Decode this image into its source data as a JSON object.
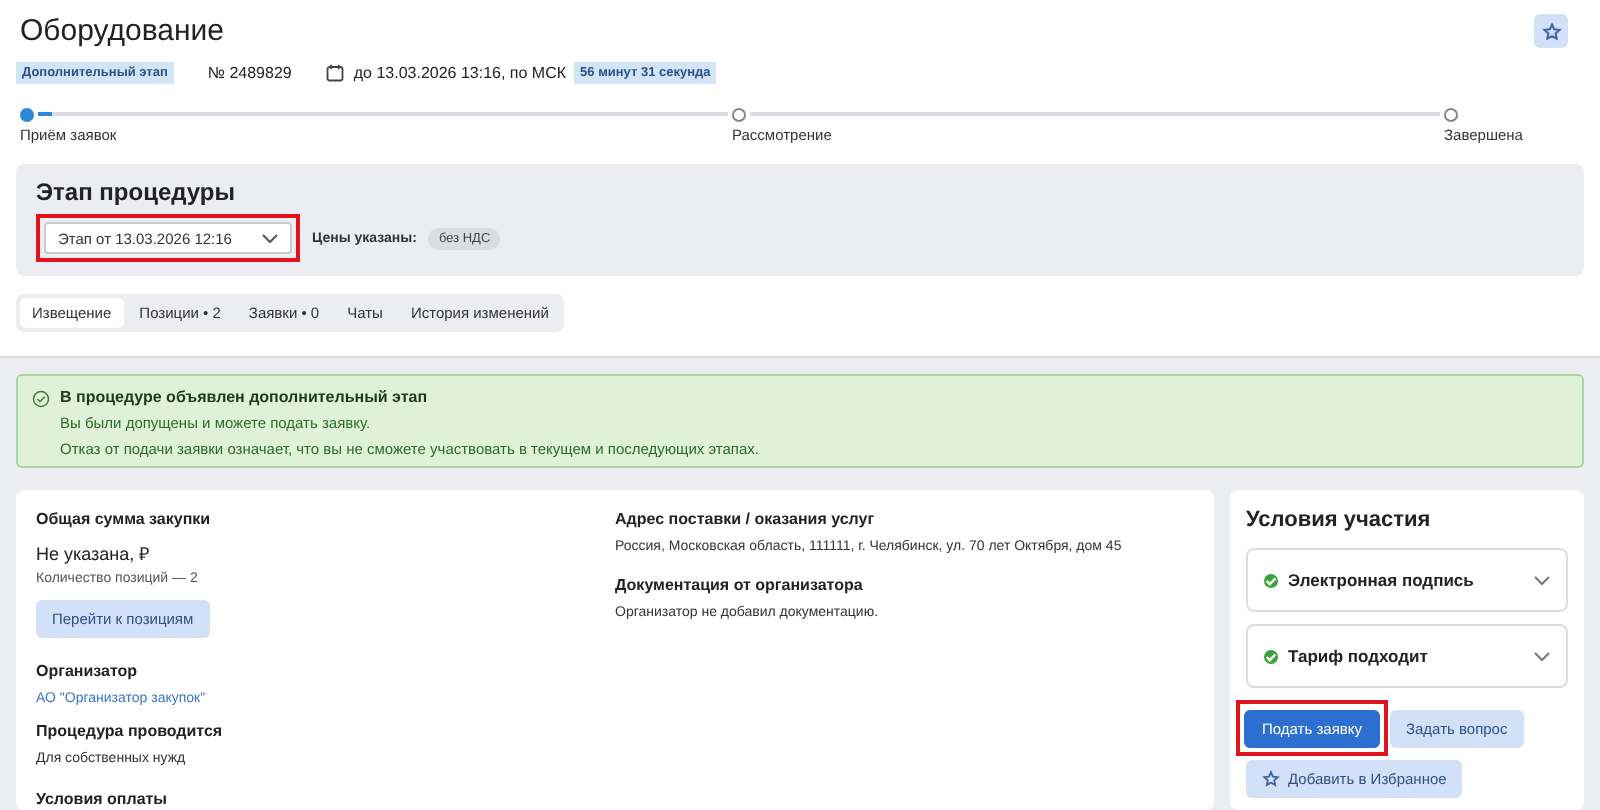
{
  "title": "Оборудование",
  "meta": {
    "stage_badge": "Дополнительный этап",
    "number": "№ 2489829",
    "deadline": "до 13.03.2026 13:16, по МСК",
    "countdown": "56 минут 31 секунда"
  },
  "steps": [
    {
      "label": "Приём заявок",
      "selected": true,
      "level": 0.02
    },
    {
      "label": "Рассмотрение",
      "selected": false
    },
    {
      "label": "Завершена",
      "selected": false
    }
  ],
  "stage_panel": {
    "title": "Этап процедуры",
    "select_value": "Этап от 13.03.2026 12:16",
    "highlighted": true,
    "prices_label": "Цены указаны:",
    "prices_tag": "без НДС"
  },
  "tabs": [
    {
      "label": "Извещение",
      "selected": true
    },
    {
      "label": "Позиции • 2",
      "selected": false
    },
    {
      "label": "Заявки • 0",
      "selected": false
    },
    {
      "label": "Чаты",
      "selected": false
    },
    {
      "label": "История изменений",
      "selected": false
    }
  ],
  "alert": {
    "title": "В процедуре объявлен дополнительный этап",
    "lines": [
      "Вы были допущены и можете подать заявку.",
      "Отказ от подачи заявки означает, что вы не сможете участвовать в текущем и последующих этапах."
    ]
  },
  "details_left": {
    "sum_heading": "Общая сумма закупки",
    "sum_value": "Не указана, ₽",
    "positions_count": "Количество позиций — 2",
    "positions_button": "Перейти к позициям",
    "organizer_heading": "Организатор",
    "organizer_link": "АО \"Организатор закупок\"",
    "procedure_heading": "Процедура проводится",
    "procedure_value": "Для собственных нужд",
    "payment_heading": "Условия оплаты"
  },
  "details_right": {
    "address_heading": "Адрес поставки / оказания услуг",
    "address_value": "Россия, Московская область, 111111, г. Челябинск, ул. 70 лет Октября, дом 45",
    "docs_heading": "Документация от организатора",
    "docs_value": "Организатор не добавил документацию."
  },
  "conditions": {
    "title": "Условия участия",
    "items": [
      {
        "label": "Электронная подпись",
        "checked": true
      },
      {
        "label": "Тариф подходит",
        "checked": true
      }
    ],
    "submit_button": {
      "label": "Подать заявку",
      "highlighted": true
    },
    "question_button": "Задать вопрос",
    "favorite_button": "Добавить в Избранное"
  }
}
